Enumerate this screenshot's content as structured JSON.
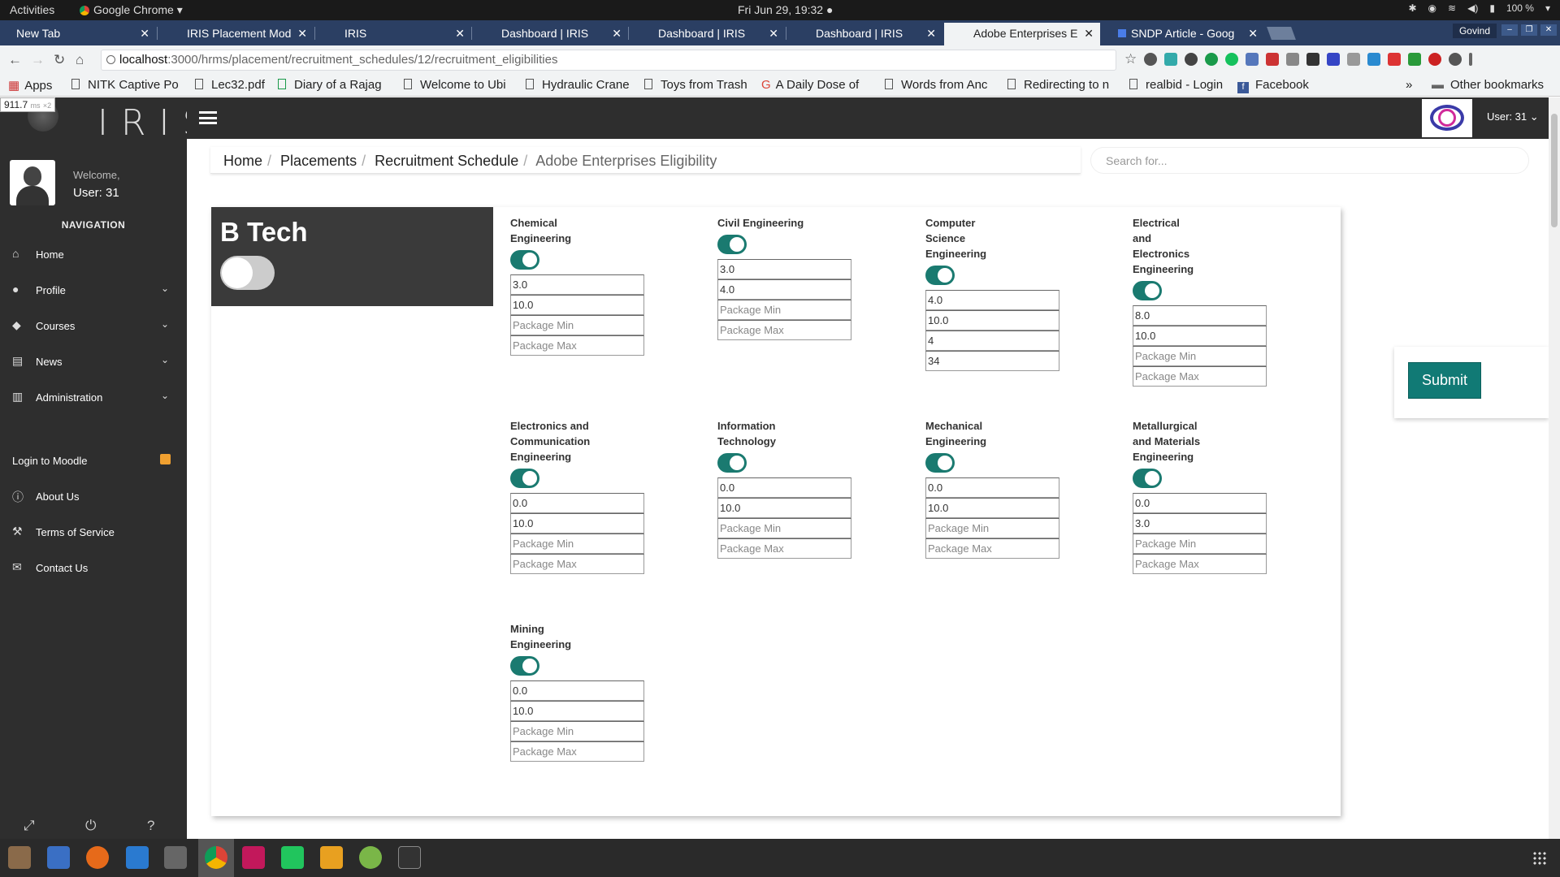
{
  "os": {
    "activities": "Activities",
    "app_name": "Google Chrome",
    "clock": "Fri Jun 29, 19:32 ●",
    "battery": "100 %"
  },
  "browser": {
    "tabs": [
      {
        "title": "New Tab",
        "active": false
      },
      {
        "title": "IRIS Placement Mod",
        "active": false
      },
      {
        "title": "IRIS",
        "active": false
      },
      {
        "title": "Dashboard | IRIS",
        "active": false
      },
      {
        "title": "Dashboard | IRIS",
        "active": false
      },
      {
        "title": "Dashboard | IRIS",
        "active": false
      },
      {
        "title": "Adobe Enterprises E",
        "active": true
      },
      {
        "title": "SNDP Article - Goog",
        "active": false
      }
    ],
    "profile": "Govind",
    "url_host": "localhost",
    "url_rest": ":3000/hrms/placement/recruitment_schedules/12/recruitment_eligibilities",
    "bookmarks": [
      "Apps",
      "NITK Captive Po",
      "Lec32.pdf",
      "Diary of a Rajag",
      "Welcome to Ubi",
      "Hydraulic Crane",
      "Toys from Trash",
      "A Daily Dose of",
      "Words from Anc",
      "Redirecting to n",
      "realbid - Login",
      "Facebook",
      "»",
      "Other bookmarks"
    ]
  },
  "latency": {
    "value": "911.7",
    "unit": "ms",
    "mult": "×2"
  },
  "sidebar": {
    "welcome": "Welcome,",
    "user": "User: 31",
    "nav_heading": "NAVIGATION",
    "items": [
      {
        "label": "Home",
        "icon": "home-icon"
      },
      {
        "label": "Profile",
        "icon": "user-icon"
      },
      {
        "label": "Courses",
        "icon": "graduation-cap-icon"
      },
      {
        "label": "News",
        "icon": "newspaper-icon"
      },
      {
        "label": "Administration",
        "icon": "institution-icon"
      }
    ],
    "links": [
      {
        "label": "Login to Moodle",
        "icon": "moodle-icon"
      },
      {
        "label": "About Us",
        "icon": "info-icon"
      },
      {
        "label": "Terms of Service",
        "icon": "gavel-icon"
      },
      {
        "label": "Contact Us",
        "icon": "envelope-icon"
      }
    ]
  },
  "header": {
    "user": "User: 31 ⌄"
  },
  "breadcrumb": {
    "items": [
      "Home",
      "Placements",
      "Recruitment Schedule"
    ],
    "current": "Adobe Enterprises Eligibility"
  },
  "search": {
    "placeholder": "Search for..."
  },
  "degree": {
    "name": "B Tech",
    "enabled": false
  },
  "placeholders": {
    "package_min": "Package Min",
    "package_max": "Package Max"
  },
  "branches": [
    {
      "name": "Chemical Engineering",
      "enabled": true,
      "v1": "3.0",
      "v2": "10.0",
      "v3": "",
      "v4": ""
    },
    {
      "name": "Civil Engineering",
      "enabled": true,
      "v1": "3.0",
      "v2": "4.0",
      "v3": "",
      "v4": ""
    },
    {
      "name": "Computer Science Engineering",
      "enabled": true,
      "v1": "4.0",
      "v2": "10.0",
      "v3": "4",
      "v4": "34"
    },
    {
      "name": "Electrical and Electronics Engineering",
      "enabled": true,
      "v1": "8.0",
      "v2": "10.0",
      "v3": "",
      "v4": ""
    },
    {
      "name": "Electronics and Communication Engineering",
      "enabled": true,
      "v1": "0.0",
      "v2": "10.0",
      "v3": "",
      "v4": ""
    },
    {
      "name": "Information Technology",
      "enabled": true,
      "v1": "0.0",
      "v2": "10.0",
      "v3": "",
      "v4": ""
    },
    {
      "name": "Mechanical Engineering",
      "enabled": true,
      "v1": "0.0",
      "v2": "10.0",
      "v3": "",
      "v4": ""
    },
    {
      "name": "Metallurgical and Materials Engineering",
      "enabled": true,
      "v1": "0.0",
      "v2": "3.0",
      "v3": "",
      "v4": ""
    },
    {
      "name": "Mining Engineering",
      "enabled": true,
      "v1": "0.0",
      "v2": "10.0",
      "v3": "",
      "v4": ""
    }
  ],
  "submit_label": "Submit",
  "colors": {
    "accent": "#117a75",
    "sidebar": "#2e2e2e",
    "tabstrip": "#2b3f63"
  }
}
